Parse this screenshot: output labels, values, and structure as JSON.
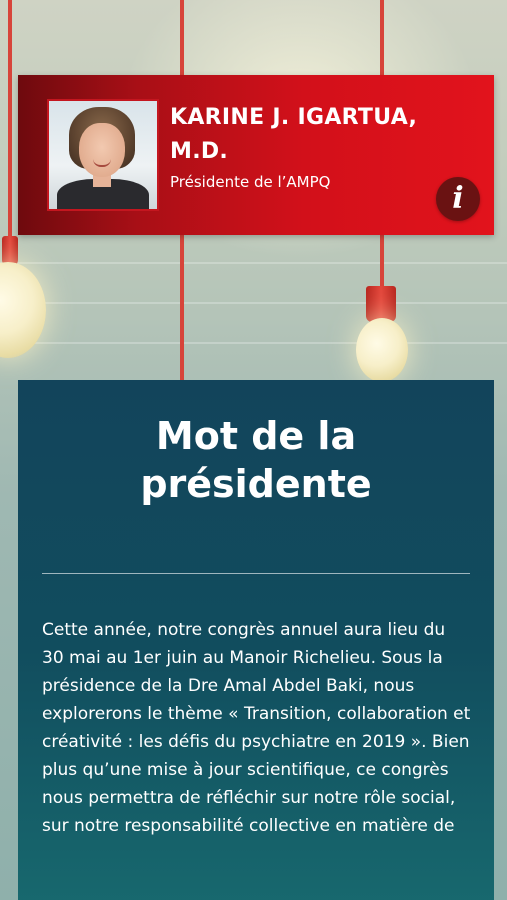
{
  "profile": {
    "name": "KARINE J. IGARTUA, M.D.",
    "role": "Présidente de l’AMPQ",
    "info_icon": "info-icon",
    "accent_color": "#d2101a"
  },
  "content": {
    "title": "Mot de la présidente",
    "body": "Cette année, notre congrès annuel aura lieu du 30 mai au 1er juin au Manoir Richelieu. Sous la présidence de la Dre Amal Abdel Baki, nous explorerons le thème « Transition, collaboration et créativité : les défis du psychiatre en 2019 ». Bien plus qu’une mise à jour scientifique, ce congrès nous permettra de réfléchir sur notre rôle social, sur notre responsabilité collective en matière de",
    "background_color": "#12445b"
  }
}
